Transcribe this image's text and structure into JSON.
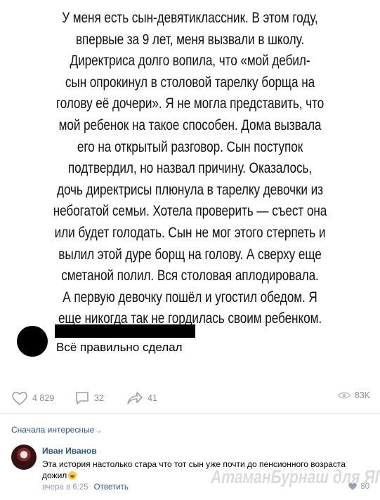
{
  "post": {
    "story_lines": [
      "У меня есть сын-девятиклассник. В этом году,",
      "впервые за 9 лет, меня вызвали в школу.",
      "Директриса долго вопила, что «мой дебил-",
      "сын опрокинул в столовой тарелку борща на",
      "голову её дочери». Я не могла представить, что",
      "мой ребенок на такое способен. Дома вызвала",
      "его на открытый разговор. Сын поступок",
      "подтвердил, но назвал причину. Оказалось,",
      "дочь директрисы плюнула в тарелку девочки из",
      "небогатой семьи. Хотела проверить — съест она",
      "или будет голодать. Сын не мог этого стерпеть и",
      "вылил этой дуре борщ на голову. А сверху еще",
      "сметаной полил. Вся столовая аплодировала.",
      "А первую девочку пошёл и угостил обедом. Я",
      "еще никогда так не гордилась своим ребенком."
    ],
    "quote_comment": "Всё правильно сделал"
  },
  "actions": {
    "likes": "4 829",
    "comments": "32",
    "shares": "41",
    "views": "83K"
  },
  "comments_section": {
    "sort_label": "Сначала интересные",
    "comment": {
      "author": "Иван Иванов",
      "text": "Эта история настолько стара что тот сын уже почти до пенсионного возраста дожил",
      "time": "вчера в 6:25",
      "reply_label": "Ответить",
      "likes": "80"
    }
  },
  "watermark": "АтаманБурнаш для ЯП",
  "colors": {
    "link": "#2a5885",
    "muted": "#828a99",
    "separator": "#e7e8ec"
  },
  "icons": [
    "heart-icon",
    "comment-bubble-icon",
    "share-arrow-icon",
    "eye-icon",
    "chevron-down-icon",
    "smile-emoji-icon"
  ]
}
